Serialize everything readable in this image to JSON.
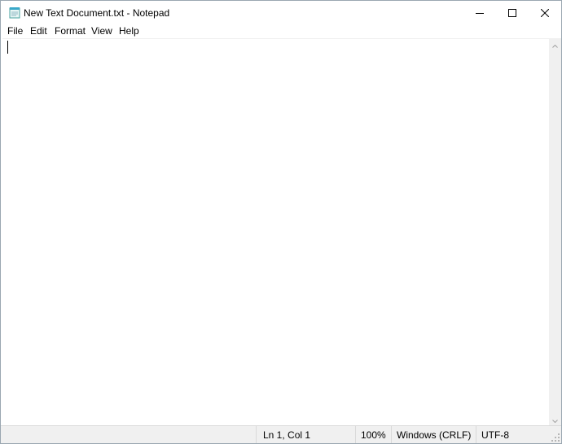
{
  "window": {
    "title": "New Text Document.txt - Notepad",
    "app_icon": "notepad-icon",
    "controls": {
      "minimize": "minimize-icon",
      "maximize": "maximize-icon",
      "close": "close-icon"
    }
  },
  "menu": {
    "items": [
      {
        "label": "File"
      },
      {
        "label": "Edit"
      },
      {
        "label": "Format"
      },
      {
        "label": "View"
      },
      {
        "label": "Help"
      }
    ]
  },
  "editor": {
    "content": ""
  },
  "statusbar": {
    "position": "Ln 1, Col 1",
    "zoom": "100%",
    "line_endings": "Windows (CRLF)",
    "encoding": "UTF-8"
  },
  "colors": {
    "window_border": "#9aa7b1",
    "statusbar_bg": "#f0f0f0",
    "scrollbar_bg": "#f0f0f0"
  }
}
